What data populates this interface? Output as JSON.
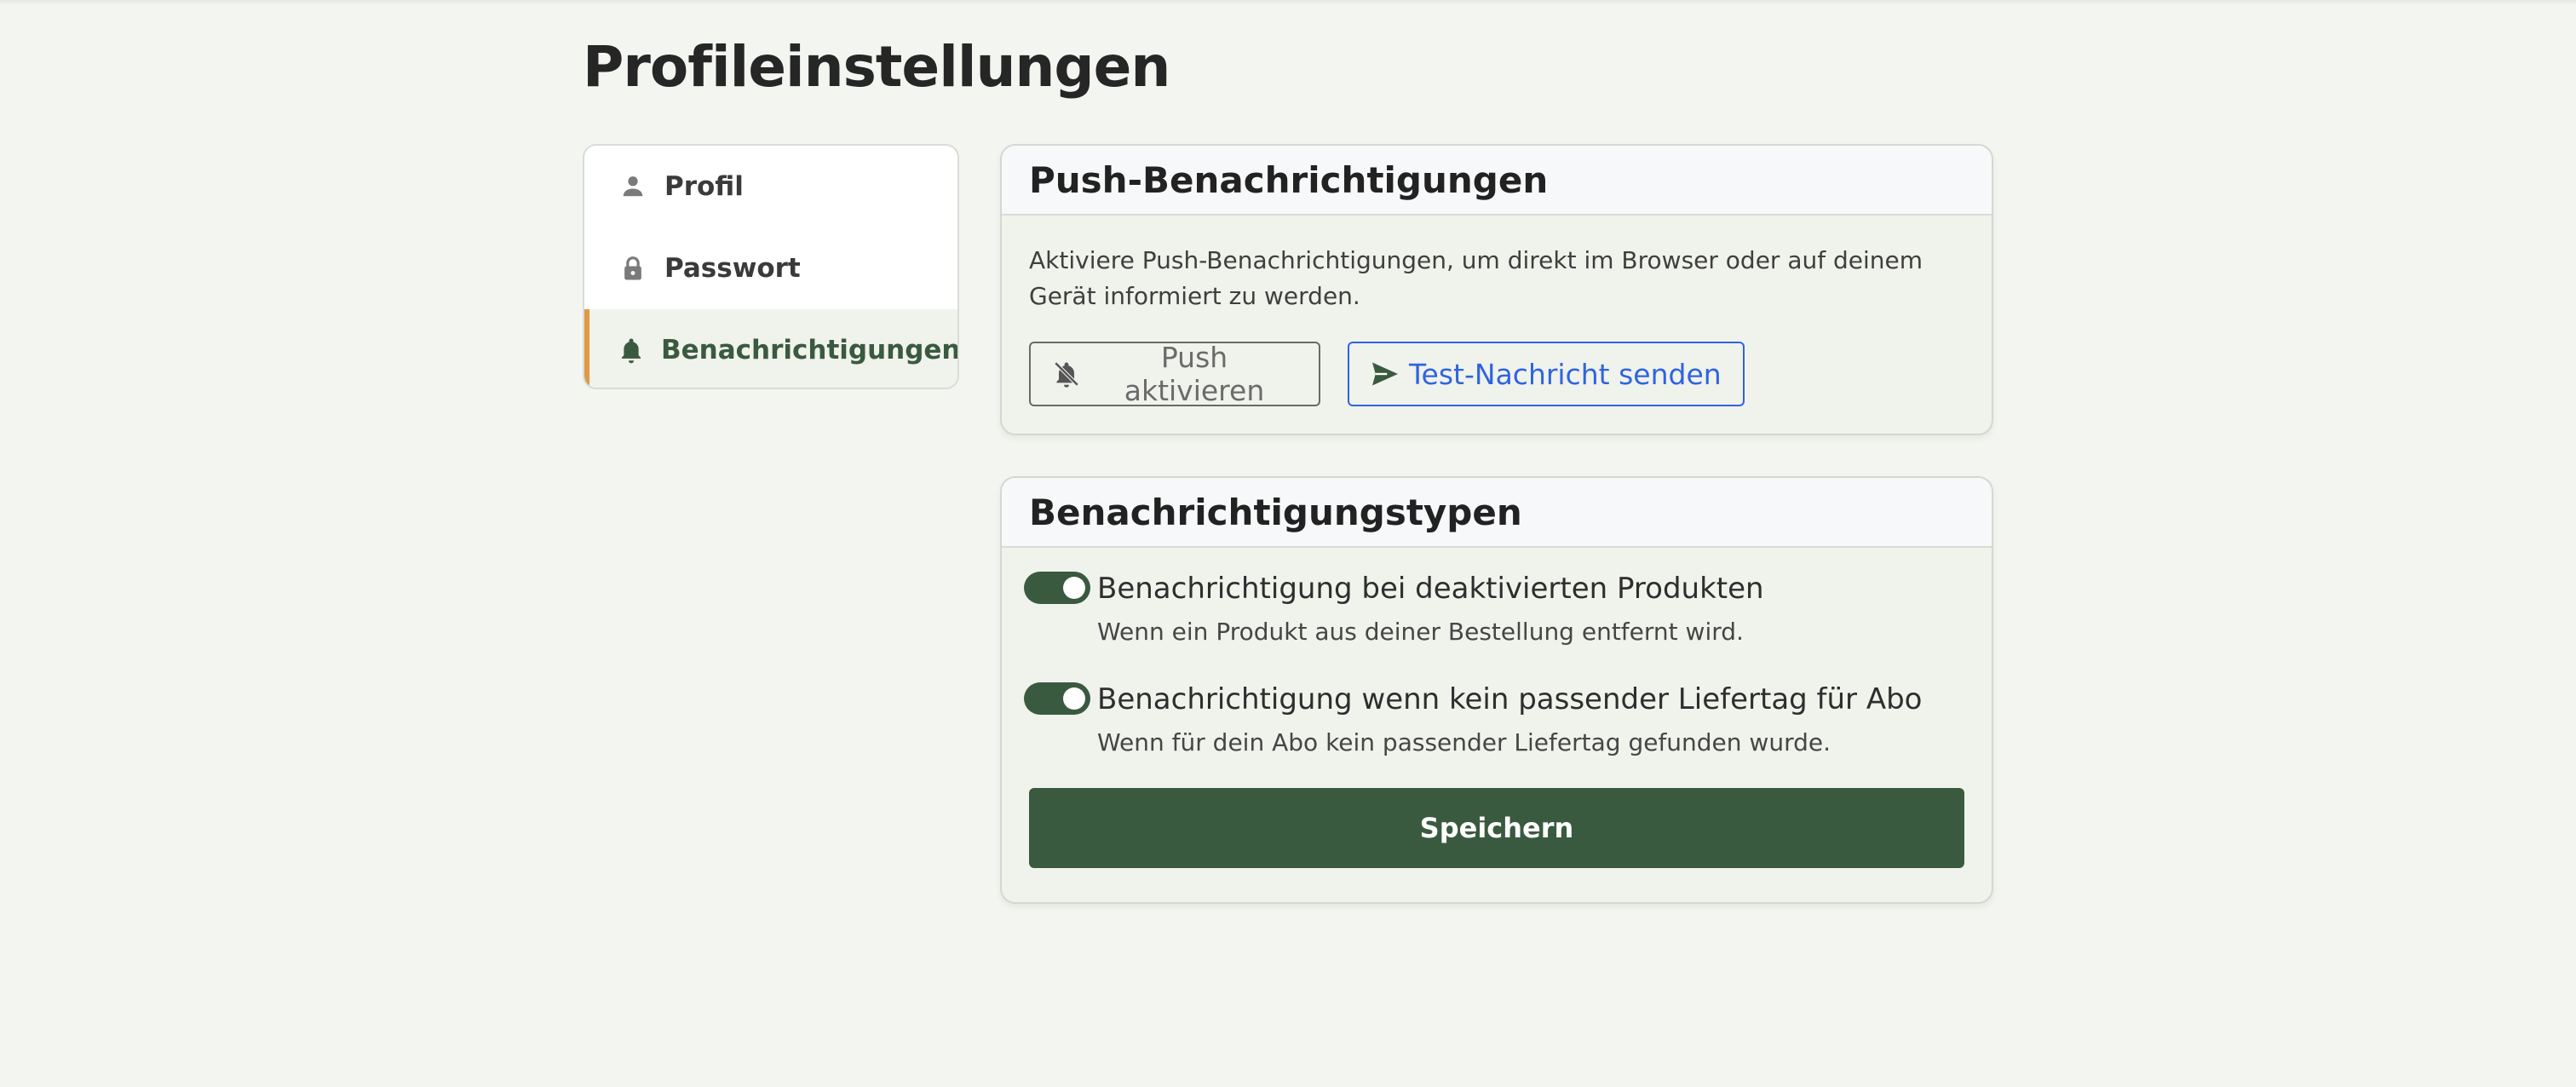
{
  "page": {
    "title": "Profileinstellungen"
  },
  "sidebar": {
    "items": [
      {
        "label": "Profil",
        "icon": "person-icon",
        "active": false
      },
      {
        "label": "Passwort",
        "icon": "lock-icon",
        "active": false
      },
      {
        "label": "Benachrichtigungen",
        "icon": "bell-icon",
        "active": true
      }
    ]
  },
  "push_card": {
    "title": "Push-Benachrichtigungen",
    "description": "Aktiviere Push-Benachrichtigungen, um direkt im Browser oder auf deinem Gerät informiert zu werden.",
    "enable_button": "Push aktivieren",
    "test_button": "Test-Nachricht senden"
  },
  "types_card": {
    "title": "Benachrichtigungstypen",
    "settings": [
      {
        "label": "Benachrichtigung bei deaktivierten Produkten",
        "description": "Wenn ein Produkt aus deiner Bestellung entfernt wird.",
        "enabled": true
      },
      {
        "label": "Benachrichtigung wenn kein passender Liefertag für Abo",
        "description": "Wenn für dein Abo kein passender Liefertag gefunden wurde.",
        "enabled": true
      }
    ],
    "save_button": "Speichern"
  },
  "colors": {
    "accent": "#3a5a40",
    "active_marker": "#e09a45",
    "link_blue": "#2f64e0",
    "background": "#f3f5f0"
  }
}
